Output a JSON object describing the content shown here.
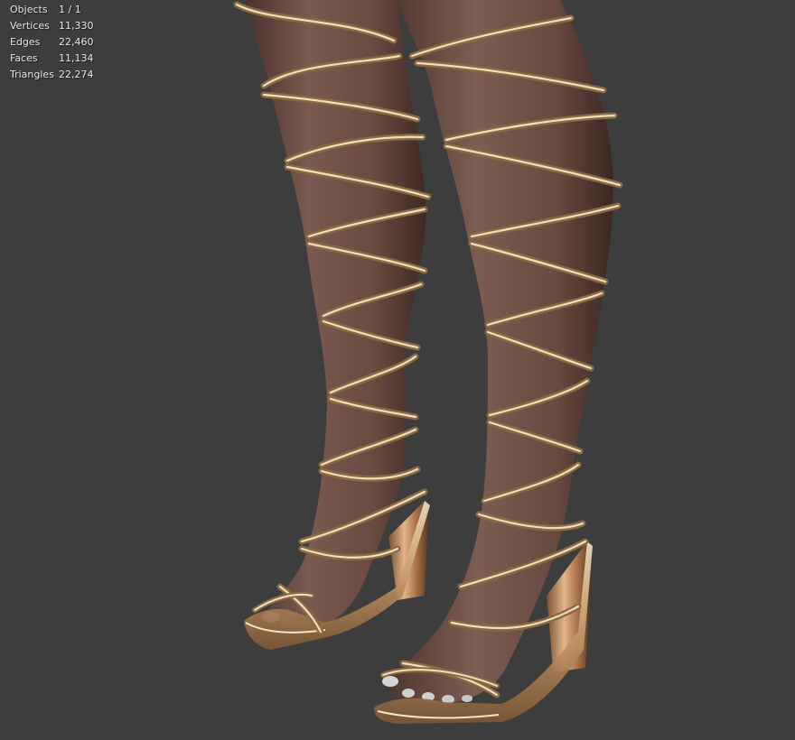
{
  "overlay": {
    "stats": [
      {
        "label": "Objects",
        "value": "1 / 1"
      },
      {
        "label": "Vertices",
        "value": "11,330"
      },
      {
        "label": "Edges",
        "value": "22,460"
      },
      {
        "label": "Faces",
        "value": "11,134"
      },
      {
        "label": "Triangles",
        "value": "22,274"
      }
    ]
  },
  "colors": {
    "background": "#3d3d3d",
    "skin": "#6e4e44",
    "skin_shadow": "#4a332c",
    "gold": "#d8b27a",
    "gold_highlight": "#f5e6c8",
    "heel": "#b5835a"
  }
}
